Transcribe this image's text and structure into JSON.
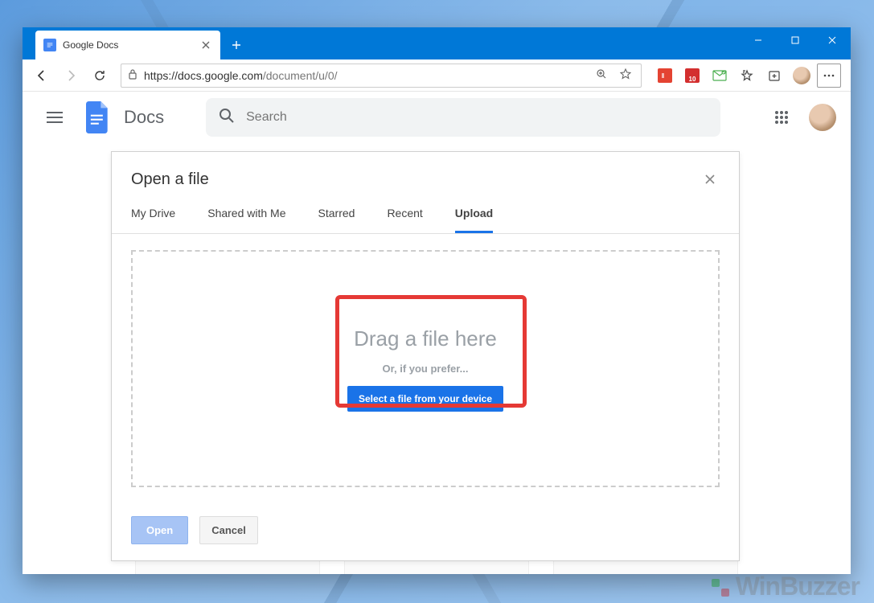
{
  "browser": {
    "tab_title": "Google Docs",
    "url_host": "https://docs.google.com",
    "url_path": "/document/u/0/",
    "calendar_badge": "10"
  },
  "docs": {
    "app_name": "Docs",
    "search_placeholder": "Search"
  },
  "picker": {
    "title": "Open a file",
    "tabs": [
      "My Drive",
      "Shared with Me",
      "Starred",
      "Recent",
      "Upload"
    ],
    "active_tab": "Upload",
    "drag_title": "Drag a file here",
    "drag_sub": "Or, if you prefer...",
    "select_button": "Select a file from your device",
    "open_button": "Open",
    "cancel_button": "Cancel"
  },
  "watermark": "WinBuzzer"
}
